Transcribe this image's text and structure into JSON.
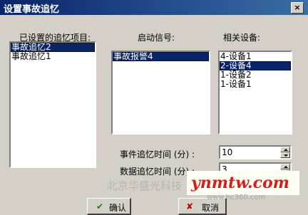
{
  "window": {
    "title": "设置事故追忆",
    "close_glyph": "×"
  },
  "left_panel": {
    "label": "已设置的追忆项目:",
    "items": [
      {
        "text": "事故追忆2",
        "selected": true
      },
      {
        "text": "事故追忆1",
        "selected": false
      }
    ]
  },
  "mid_panel": {
    "label": "启动信号:",
    "items": [
      {
        "text": "事故报警4",
        "selected": true
      }
    ]
  },
  "right_panel": {
    "label": "相关设备:",
    "items": [
      {
        "text": "4-设备1",
        "selected": false
      },
      {
        "text": "2-设备4",
        "selected": true
      },
      {
        "text": "1-设备2",
        "selected": false
      },
      {
        "text": "1-设备1",
        "selected": false
      }
    ]
  },
  "event_time": {
    "label": "事件追忆时间 (分) :",
    "value": "10"
  },
  "data_time": {
    "label": "数据追忆时间 (分) :",
    "value": "3"
  },
  "buttons": {
    "ok": "确认",
    "cancel": "取消"
  },
  "watermarks": {
    "company": "北京华盛光科技",
    "site": "ynmtw.com",
    "sub": "www.hc360.com"
  },
  "colors": {
    "titlebar": "#0a246a",
    "selection": "#0a246a",
    "face": "#d4d0c8",
    "watermark": "#d81b1b"
  }
}
